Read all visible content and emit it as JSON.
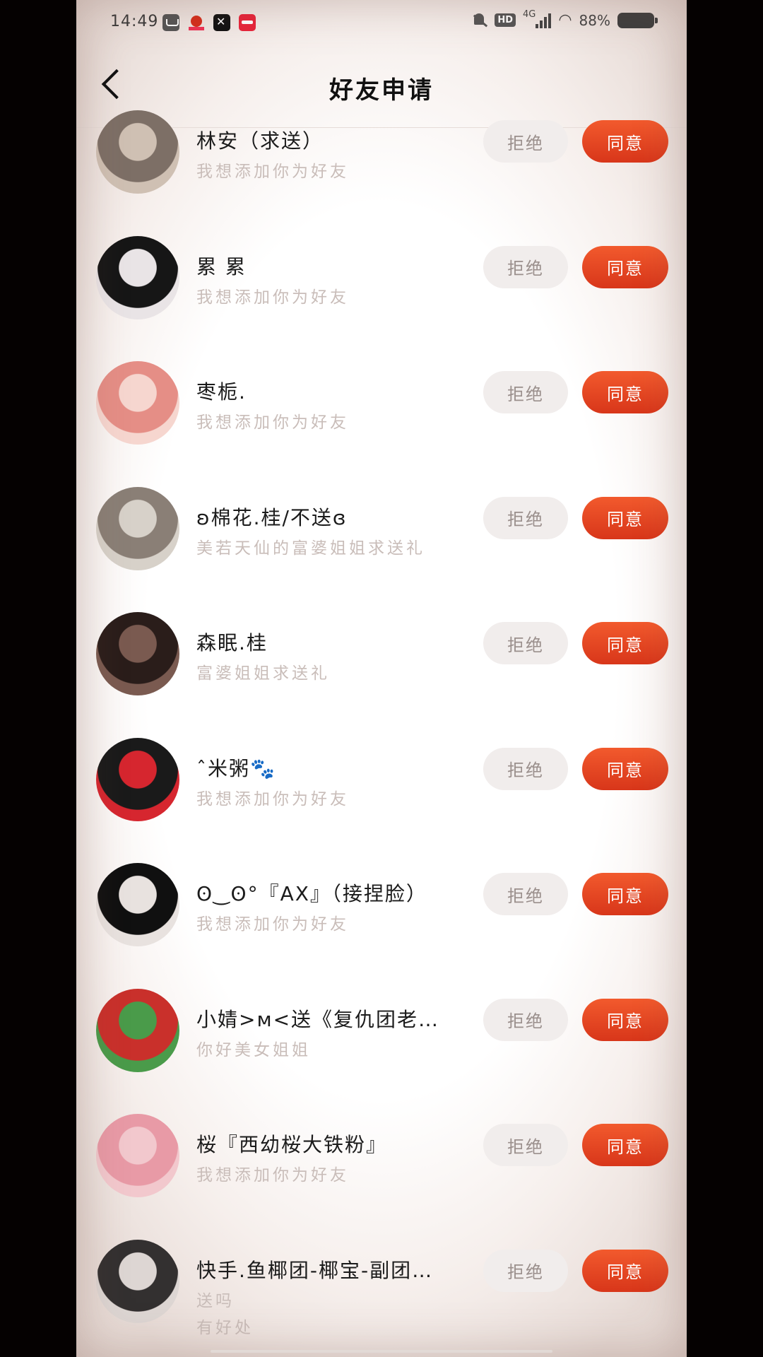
{
  "status_bar": {
    "time": "14:49",
    "battery": "88%",
    "network": "4G",
    "hd": "HD"
  },
  "header": {
    "title": "好友申请"
  },
  "requests": [
    {
      "name": "林安（求送）",
      "message": "我想添加你为好友",
      "reject_label": "拒绝",
      "accept_label": "同意",
      "avatar_colors": [
        "#cfc0b3",
        "#7d6f66"
      ]
    },
    {
      "name": "累 累",
      "message": "我想添加你为好友",
      "reject_label": "拒绝",
      "accept_label": "同意",
      "avatar_colors": [
        "#e9e4e6",
        "#161616"
      ]
    },
    {
      "name": "枣栀.",
      "message": "我想添加你为好友",
      "reject_label": "拒绝",
      "accept_label": "同意",
      "avatar_colors": [
        "#f6d6cf",
        "#e58e86"
      ]
    },
    {
      "name": "ʚ棉花.桂/不送ɞ",
      "message": "美若天仙的富婆姐姐求送礼",
      "reject_label": "拒绝",
      "accept_label": "同意",
      "avatar_colors": [
        "#d7d1c9",
        "#8a7f76"
      ]
    },
    {
      "name": "森眠.桂",
      "message": "富婆姐姐求送礼",
      "reject_label": "拒绝",
      "accept_label": "同意",
      "avatar_colors": [
        "#7a5a50",
        "#2a1d1a"
      ]
    },
    {
      "name": "ˆ米粥🐾",
      "message": "我想添加你为好友",
      "reject_label": "拒绝",
      "accept_label": "同意",
      "avatar_colors": [
        "#d6262f",
        "#1a1a1a"
      ]
    },
    {
      "name": "ʘ‿ʘ°『AX』（接捏脸）",
      "message": "我想添加你为好友",
      "reject_label": "拒绝",
      "accept_label": "同意",
      "avatar_colors": [
        "#e8e2df",
        "#101010"
      ]
    },
    {
      "name": "小婧>м<送《复仇团老…",
      "message": "你好美女姐姐",
      "reject_label": "拒绝",
      "accept_label": "同意",
      "avatar_colors": [
        "#4a9b4a",
        "#c9302b"
      ]
    },
    {
      "name": "桜『西幼桜大铁粉』",
      "message": "我想添加你为好友",
      "reject_label": "拒绝",
      "accept_label": "同意",
      "avatar_colors": [
        "#f2c8cd",
        "#e89aa6"
      ]
    },
    {
      "name": "快手.鱼椰团-椰宝-副团…",
      "message": "送吗\n有好处",
      "reject_label": "拒绝",
      "accept_label": "同意",
      "avatar_colors": [
        "#ddd6d3",
        "#333030"
      ]
    }
  ]
}
